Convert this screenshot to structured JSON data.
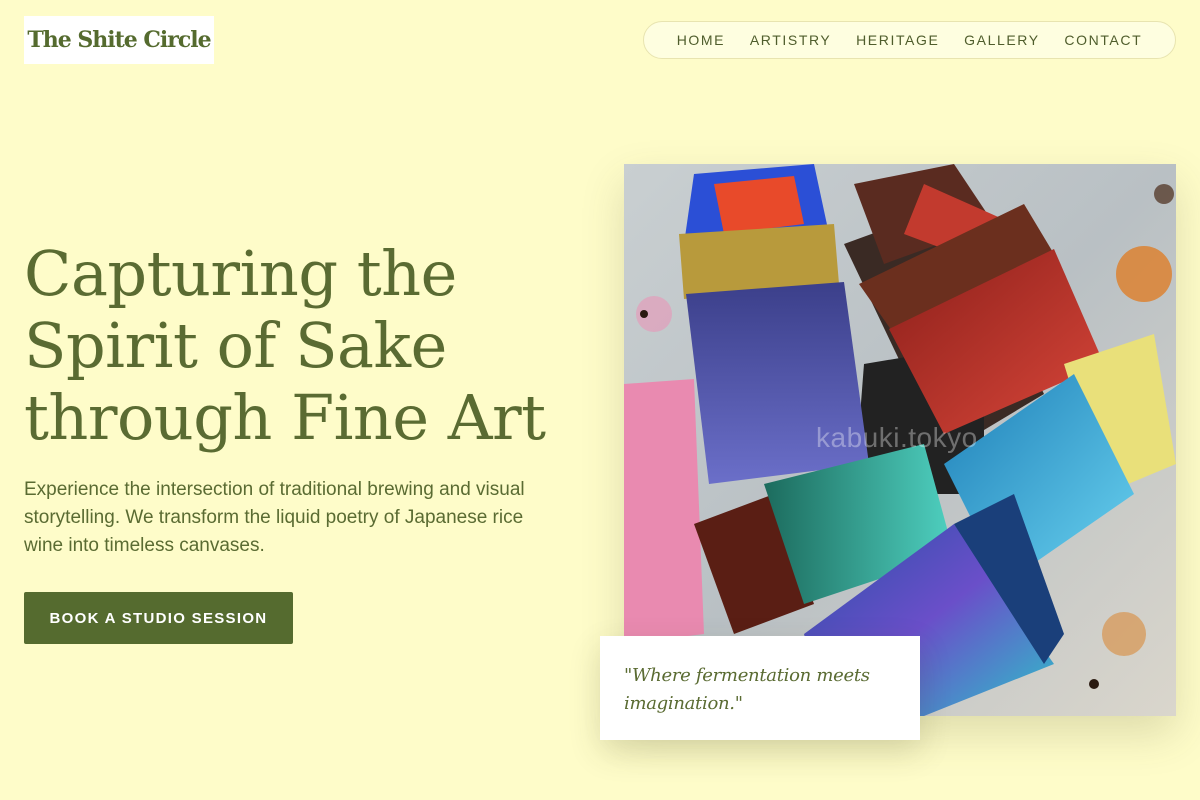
{
  "header": {
    "logo_text": "The Shite Circle",
    "nav": [
      {
        "label": "HOME"
      },
      {
        "label": "ARTISTRY"
      },
      {
        "label": "HERITAGE"
      },
      {
        "label": "GALLERY"
      },
      {
        "label": "CONTACT"
      }
    ]
  },
  "hero": {
    "title_lines": [
      "Capturing the",
      "Spirit of Sake",
      "through Fine Art"
    ],
    "description": "Experience the intersection of traditional brewing and visual storytelling. We transform the liquid poetry of Japanese rice wine into timeless canvases.",
    "cta_label": "BOOK A STUDIO SESSION"
  },
  "artwork": {
    "watermark": "kabuki.tokyo",
    "quote": "\"Where fermentation meets imagination.\""
  },
  "colors": {
    "background": "#fefcc9",
    "accent": "#556b2f",
    "card": "#ffffff"
  }
}
